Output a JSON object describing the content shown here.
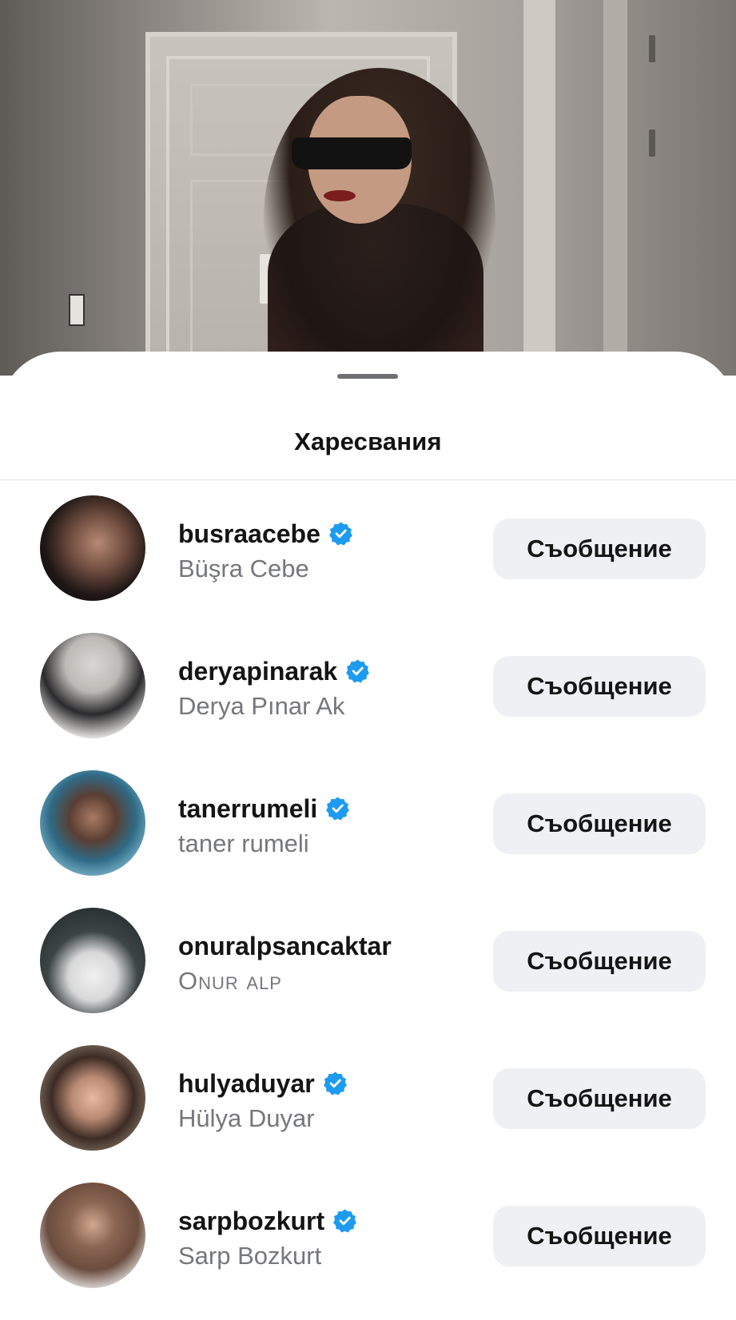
{
  "sheet": {
    "title": "Харесвания"
  },
  "likes": [
    {
      "username": "busraacebe",
      "full_name": "Büşra Cebe",
      "verified": true,
      "button_label": "Съобщение"
    },
    {
      "username": "deryapinarak",
      "full_name": "Derya Pınar Ak",
      "verified": true,
      "button_label": "Съобщение"
    },
    {
      "username": "tanerrumeli",
      "full_name": "taner rumeli",
      "verified": true,
      "button_label": "Съобщение"
    },
    {
      "username": "onuralpsancaktar",
      "full_name": "Onur alp",
      "verified": false,
      "button_label": "Съобщение"
    },
    {
      "username": "hulyaduyar",
      "full_name": "Hülya Duyar",
      "verified": true,
      "button_label": "Съобщение"
    },
    {
      "username": "sarpbozkurt",
      "full_name": "Sarp Bozkurt",
      "verified": true,
      "button_label": "Съобщение"
    }
  ],
  "icons": {
    "verified": "verified-badge-icon"
  },
  "colors": {
    "verified_blue": "#1d9bf0",
    "button_bg": "#eff0f4",
    "secondary_text": "#76777c"
  }
}
